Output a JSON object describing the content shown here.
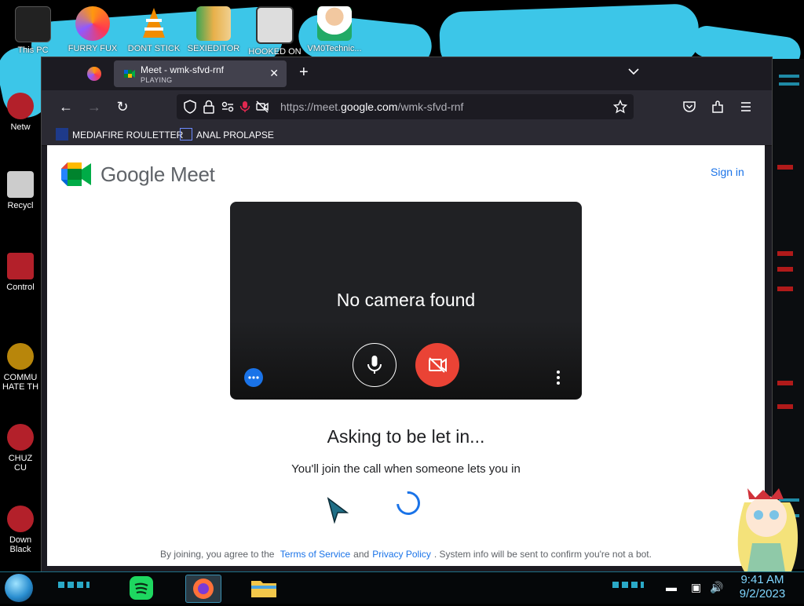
{
  "desktop": {
    "icons": [
      {
        "label": "This PC"
      },
      {
        "label": "FURRY FUX"
      },
      {
        "label": "DONT STICK"
      },
      {
        "label": "SEXIEDITOR"
      },
      {
        "label": "HOOKED ON"
      },
      {
        "label": "VM0Technic..."
      }
    ],
    "left_icons": [
      {
        "label": "Netw"
      },
      {
        "label": "Recycl"
      },
      {
        "label": "Control"
      },
      {
        "label": "COMMU\nHATE TH"
      },
      {
        "label": "CHUZ\nCU"
      },
      {
        "label": "Down\nBlack"
      }
    ]
  },
  "browser": {
    "tab": {
      "title": "Meet - wmk-sfvd-rnf",
      "subtitle": "PLAYING"
    },
    "url_prefix": "https://meet.",
    "url_domain": "google.com",
    "url_path": "/wmk-sfvd-rnf",
    "bookmarks": [
      {
        "label": "MEDIAFIRE ROULETTER"
      },
      {
        "label": "ANAL PROLAPSE"
      }
    ]
  },
  "meet": {
    "brand": "Google Meet",
    "signin": "Sign in",
    "video_message": "No camera found",
    "asking": "Asking to be let in...",
    "join_message": "You'll join the call when someone lets you in",
    "footer_prefix": "By joining, you agree to the",
    "terms": "Terms of Service",
    "and": "and",
    "privacy": "Privacy Policy",
    "footer_suffix": ". System info will be sent to confirm you're not a bot."
  },
  "taskbar": {
    "time": "9:41 AM",
    "date": "9/2/2023"
  },
  "colors": {
    "meet_blue": "#1a73e8",
    "cam_red": "#ea4335",
    "wallpaper_cyan": "#3cc6e8"
  }
}
